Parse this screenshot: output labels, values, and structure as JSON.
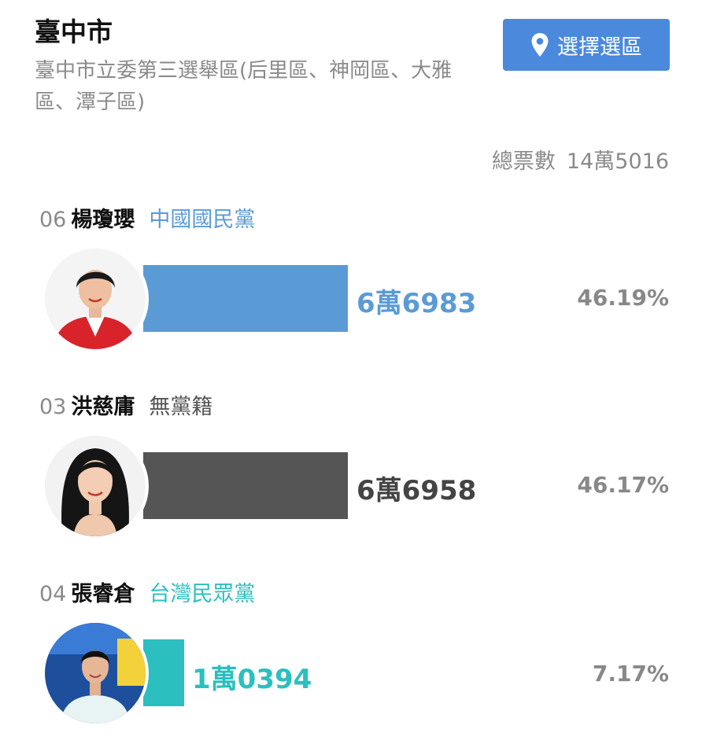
{
  "header": {
    "city": "臺中市",
    "district": "臺中市立委第三選舉區(后里區、神岡區、大雅區、潭子區)",
    "select_button_label": "選擇選區",
    "total_label": "總票數",
    "total_value": "14萬5016"
  },
  "colors": {
    "kmt": "#5b9bd5",
    "independent": "#555555",
    "tpp": "#2bbfbf",
    "button": "#4a89dc"
  },
  "candidates": [
    {
      "number": "06",
      "name": "楊瓊瓔",
      "party": "中國國民黨",
      "votes": "6萬6983",
      "percent": "46.19%",
      "avatar_icon": "candidate-photo"
    },
    {
      "number": "03",
      "name": "洪慈庸",
      "party": "無黨籍",
      "votes": "6萬6958",
      "percent": "46.17%",
      "avatar_icon": "candidate-photo"
    },
    {
      "number": "04",
      "name": "張睿倉",
      "party": "台灣民眾黨",
      "votes": "1萬0394",
      "percent": "7.17%",
      "avatar_icon": "candidate-photo"
    }
  ]
}
